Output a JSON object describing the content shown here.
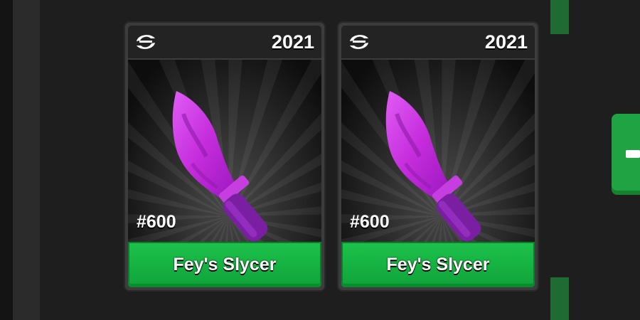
{
  "cards": [
    {
      "year": "2021",
      "serial": "#600",
      "name": "Fey's Slycer",
      "icon": "chroma-swirl-icon"
    },
    {
      "year": "2021",
      "serial": "#600",
      "name": "Fey's Slycer",
      "icon": "chroma-swirl-icon"
    }
  ],
  "colors": {
    "button_green": "#1ec24a",
    "blade_purple": "#c62be0",
    "background": "#1e1e1e"
  }
}
